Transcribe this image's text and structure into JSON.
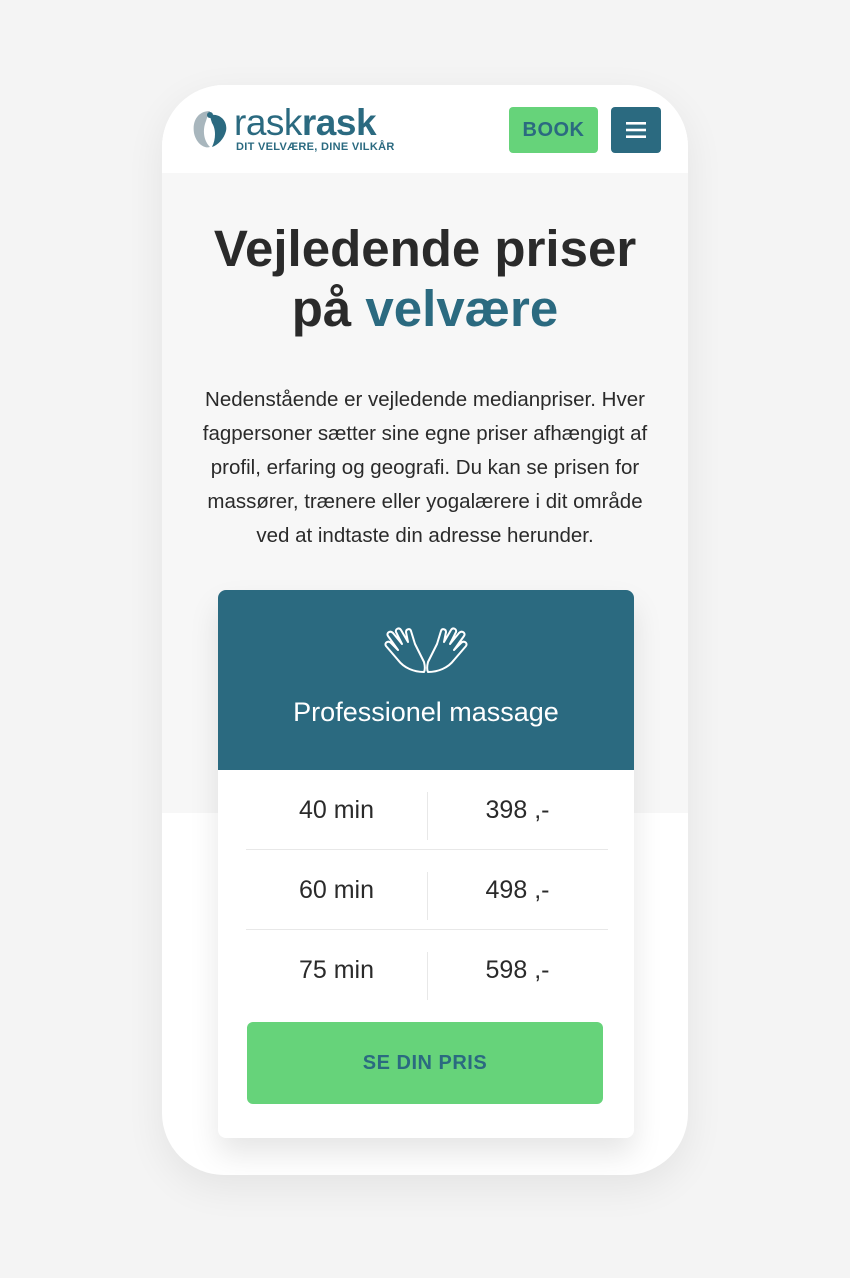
{
  "header": {
    "logo_light": "rask",
    "logo_bold": "rask",
    "tagline": "DIT VELVÆRE, DINE VILKÅR",
    "book_label": "BOOK",
    "menu_icon": "hamburger-icon"
  },
  "hero": {
    "title_line1": "Vejledende priser",
    "title_line2_prefix": "på ",
    "title_line2_accent": "velvære",
    "intro": "Nedenstående er vejledende medianpriser. Hver fagpersoner sætter sine egne priser afhængigt af profil, erfaring og geografi. Du kan se prisen for massører, trænere eller yogalærere i dit område ved at indtaste din adresse herunder."
  },
  "card": {
    "icon": "massage-hands-icon",
    "title": "Professionel massage",
    "rows": [
      {
        "duration": "40 min",
        "price": "398 ,-"
      },
      {
        "duration": "60 min",
        "price": "498 ,-"
      },
      {
        "duration": "75 min",
        "price": "598 ,-"
      }
    ],
    "cta_label": "SE DIN PRIS"
  },
  "colors": {
    "brand_teal": "#2b6a80",
    "brand_green": "#66d37a",
    "text": "#2a2a2a",
    "page_bg": "#f4f4f4"
  }
}
